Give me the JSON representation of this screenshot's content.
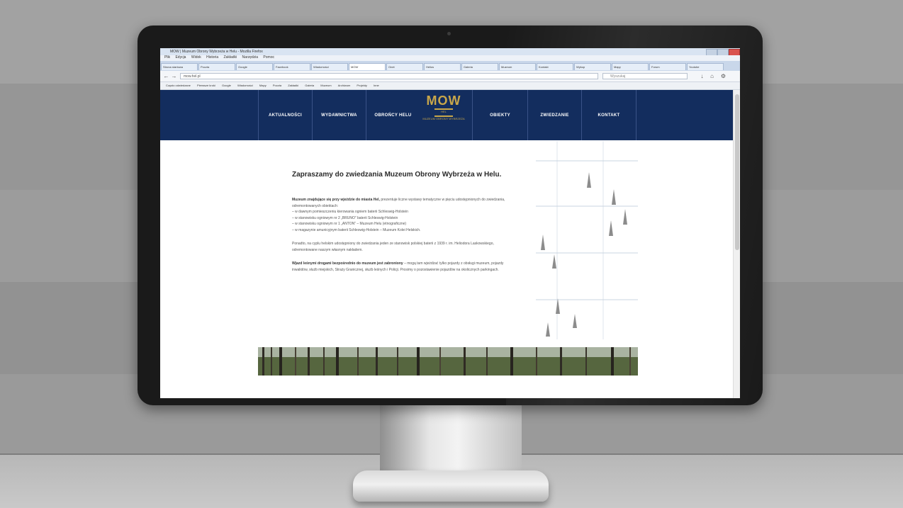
{
  "browser": {
    "window_title": "MOW | Muzeum Obrony Wybrzeża w Helu - Mozilla Firefox",
    "menu": [
      "Plik",
      "Edycja",
      "Widok",
      "Historia",
      "Zakładki",
      "Narzędzia",
      "Pomoc"
    ],
    "tabs": [
      "Strona startowa",
      "Poczta",
      "Google",
      "Facebook",
      "Wiadomości",
      "MOW",
      "Onet",
      "Helios",
      "Galeria",
      "Muzeum",
      "Kontakt",
      "Wykop",
      "Mapy",
      "Forum",
      "Youtube"
    ],
    "url": "mow.hel.pl",
    "search_placeholder": "Wyszukaj",
    "bookmarks": [
      "Często odwiedzane",
      "Pierwsze kroki",
      "Google",
      "Wiadomości",
      "Mapy",
      "Poczta",
      "Zakładki",
      "Galeria",
      "Muzeum",
      "Archiwum",
      "Projekty",
      "Inne"
    ]
  },
  "site": {
    "nav": [
      {
        "label": "AKTUALNOŚCI"
      },
      {
        "label": "WYDAWNICTWA"
      },
      {
        "label": "OBROŃCY HELU"
      },
      {
        "label": "OBIEKTY"
      },
      {
        "label": "ZWIEDZANIE"
      },
      {
        "label": "KONTAKT"
      }
    ],
    "logo": {
      "text": "MOW",
      "sub1": "HEL",
      "sub2": "MUZEUM OBRONY WYBRZEŻA"
    },
    "heading": "Zapraszamy do zwiedzania Muzeum Obrony Wybrzeża w Helu.",
    "intro_bold": "Muzeum znajdujące się przy wjeździe do miasta Hel,",
    "intro_rest": " prezentuje liczne wystawy tematyczne w pięciu udostępnionych do zwiedzania, odremontowanych obiektach:",
    "list": [
      "– w dawnym pomieszczeniu kierowania ogniem baterii Schleswig-Holstein",
      "– w stanowisku ogniowym nr 2 „BRUNO” baterii Schleswig-Holstein",
      "– w stanowisku ogniowym nr 1 „ANTON” – Muzeum Helu (etnograficzne)",
      "– w magazynie amunicyjnym baterii Schleswig-Holstein – Muzeum Kolei Helskich."
    ],
    "para2": "Ponadto, na cyplu helskim udostępniony do zwiedzania jeden ze stanowisk polskiej baterii z 1939 r. im. Heliodora Laskowskiego, odremontowane naszym własnym nakładem.",
    "para3_bold": "Wjazd leśnymi drogami bezpośrednio do muzeum jest zabroniony",
    "para3_rest": " – mogą tam wjeżdżać tylko pojazdy z obsługi muzeum, pojazdy inwalidów, służb miejskich, Straży Granicznej, służb leśnych i Policji. Prosimy o pozostawienie pojazdów na okolicznych parkingach."
  },
  "colors": {
    "header_bg": "#132d5e",
    "logo_gold": "#c9a74a",
    "wall": "#9a9a9a",
    "bezel": "#1a1a1a"
  }
}
